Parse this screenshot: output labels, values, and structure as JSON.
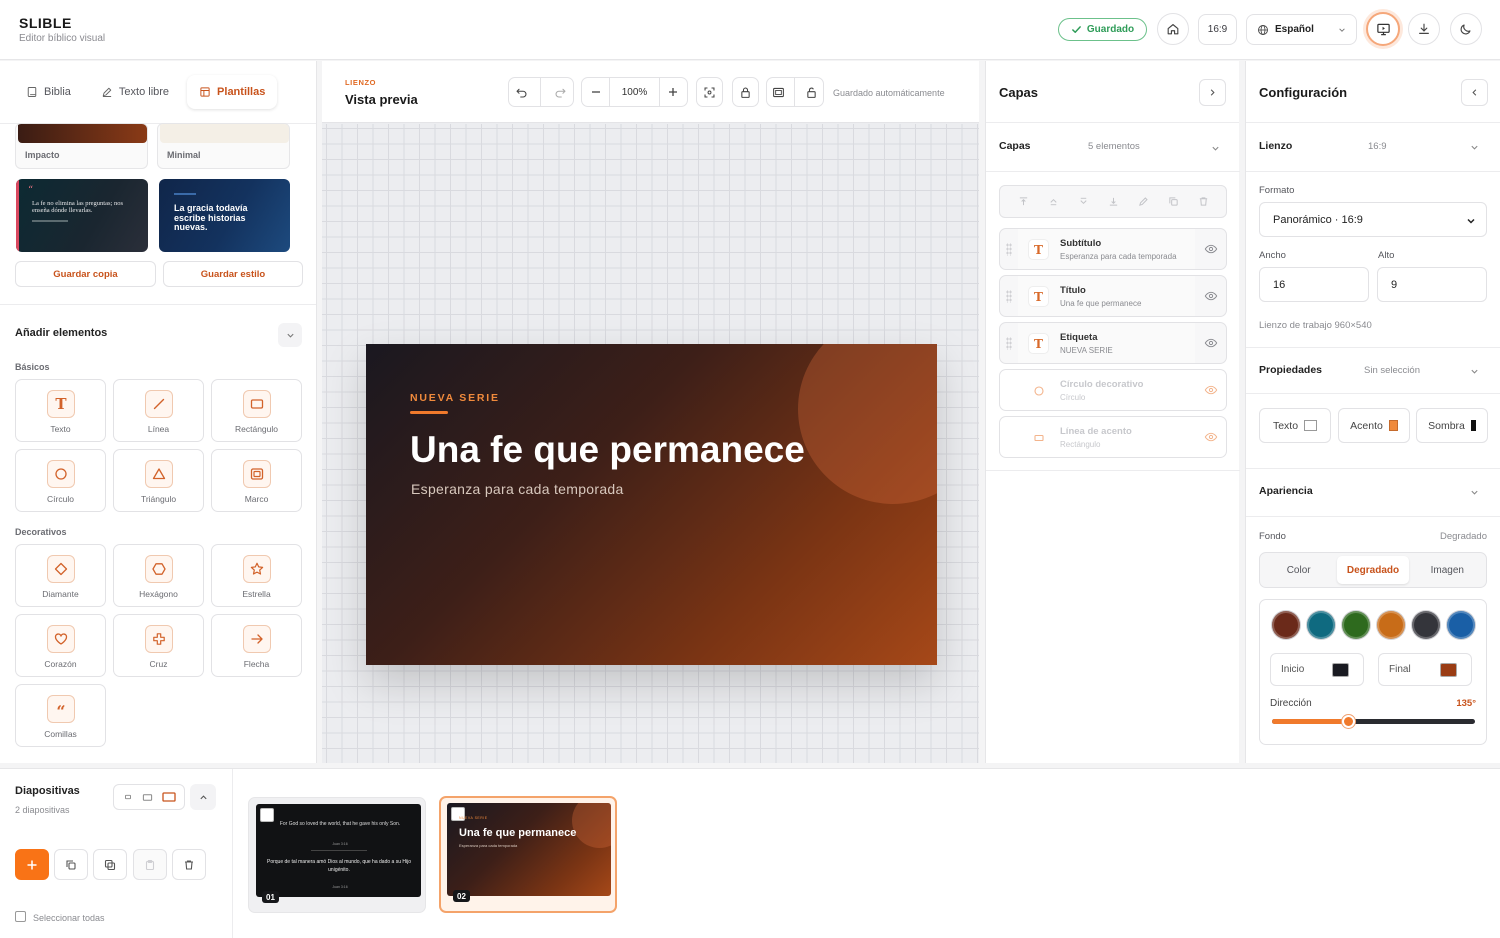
{
  "app": {
    "title": "SLIBLE",
    "subtitle": "Editor bíblico visual"
  },
  "header": {
    "saved_label": "Guardado",
    "ratio_label": "16:9",
    "language_label": "Español"
  },
  "left_panel": {
    "tabs": [
      {
        "label": "Biblia"
      },
      {
        "label": "Texto libre"
      },
      {
        "label": "Plantillas",
        "active": true
      }
    ],
    "templates_top": [
      {
        "label": "Impacto"
      },
      {
        "label": "Minimal"
      }
    ],
    "template_card_a": {
      "text": "La fe no elimina las preguntas; nos enseña dónde llevarlas."
    },
    "template_card_b": {
      "text": "La gracia todavía escribe historias nuevas."
    },
    "save_copy_label": "Guardar copia",
    "save_style_label": "Guardar estilo",
    "add_elements_title": "Añadir elementos",
    "basics_label": "Básicos",
    "decoratives_label": "Decorativos",
    "basic_elements": [
      {
        "label": "Texto",
        "icon": "text-icon"
      },
      {
        "label": "Línea",
        "icon": "line-icon"
      },
      {
        "label": "Rectángulo",
        "icon": "rectangle-icon"
      },
      {
        "label": "Círculo",
        "icon": "circle-icon"
      },
      {
        "label": "Triángulo",
        "icon": "triangle-icon"
      },
      {
        "label": "Marco",
        "icon": "frame-icon"
      }
    ],
    "decorative_elements": [
      {
        "label": "Diamante",
        "icon": "diamond-icon"
      },
      {
        "label": "Hexágono",
        "icon": "hexagon-icon"
      },
      {
        "label": "Estrella",
        "icon": "star-icon"
      },
      {
        "label": "Corazón",
        "icon": "heart-icon"
      },
      {
        "label": "Cruz",
        "icon": "cross-icon"
      },
      {
        "label": "Flecha",
        "icon": "arrow-icon"
      },
      {
        "label": "Comillas",
        "icon": "quotes-icon"
      }
    ]
  },
  "canvas": {
    "eyebrow": "LIENZO",
    "title": "Vista previa",
    "zoom": "100%",
    "autosave_label": "Guardado automáticamente",
    "slide": {
      "label": "NUEVA SERIE",
      "title": "Una fe que permanece",
      "subtitle": "Esperanza para cada temporada"
    }
  },
  "layers": {
    "title": "Capas",
    "section_label": "Capas",
    "count_label": "5 elementos",
    "items": [
      {
        "name": "Subtítulo",
        "sub": "Esperanza para cada temporada",
        "kind": "text",
        "visible": true
      },
      {
        "name": "Título",
        "sub": "Una fe que permanece",
        "kind": "text",
        "visible": true
      },
      {
        "name": "Etiqueta",
        "sub": "NUEVA SERIE",
        "kind": "text",
        "visible": true
      },
      {
        "name": "Círculo decorativo",
        "sub": "Círculo",
        "kind": "circle",
        "visible": false
      },
      {
        "name": "Línea de acento",
        "sub": "Rectángulo",
        "kind": "rect",
        "visible": false
      }
    ]
  },
  "config": {
    "title": "Configuración",
    "canvas_label": "Lienzo",
    "canvas_ratio": "16:9",
    "format_label": "Formato",
    "format_value": "Panorámico · 16:9",
    "width_label": "Ancho",
    "width_value": "16",
    "height_label": "Alto",
    "height_value": "9",
    "workspace_note": "Lienzo de trabajo 960×540",
    "properties_label": "Propiedades",
    "no_selection": "Sin selección",
    "prop_buttons": [
      {
        "label": "Texto"
      },
      {
        "label": "Acento"
      },
      {
        "label": "Sombra"
      }
    ],
    "appearance_label": "Apariencia",
    "background_label": "Fondo",
    "background_mode": "Degradado",
    "bg_tabs": [
      {
        "label": "Color"
      },
      {
        "label": "Degradado",
        "active": true
      },
      {
        "label": "Imagen"
      }
    ],
    "swatches": [
      "#6b2a1a",
      "#0f6a80",
      "#2e6a1e",
      "#c86c18",
      "#34353b",
      "#1a5fa6"
    ],
    "start_label": "Inicio",
    "start_color": "#1a1b22",
    "end_label": "Final",
    "end_color": "#9a3c14",
    "direction_label": "Dirección",
    "direction_value": "135°",
    "direction_fraction": 0.375
  },
  "slides_bar": {
    "title": "Diapositivas",
    "count_label": "2 diapositivas",
    "select_all_label": "Seleccionar todas",
    "slides": [
      {
        "number": "01",
        "line1": "For God so loved the world, that he gave his only Son.",
        "ref1": "Juan 3:16",
        "line2": "Porque de tal manera amó Dios al mundo, que ha dado a su Hijo unigénito.",
        "ref2": "Juan 3:16"
      },
      {
        "number": "02",
        "label": "NUEVA SERIE",
        "title": "Una fe que permanece",
        "subtitle": "Esperanza para cada temporada",
        "selected": true
      }
    ]
  },
  "colors": {
    "accent": "#f07a2c",
    "accent_text": "#c8531c",
    "saved_green": "#2e9c58"
  }
}
